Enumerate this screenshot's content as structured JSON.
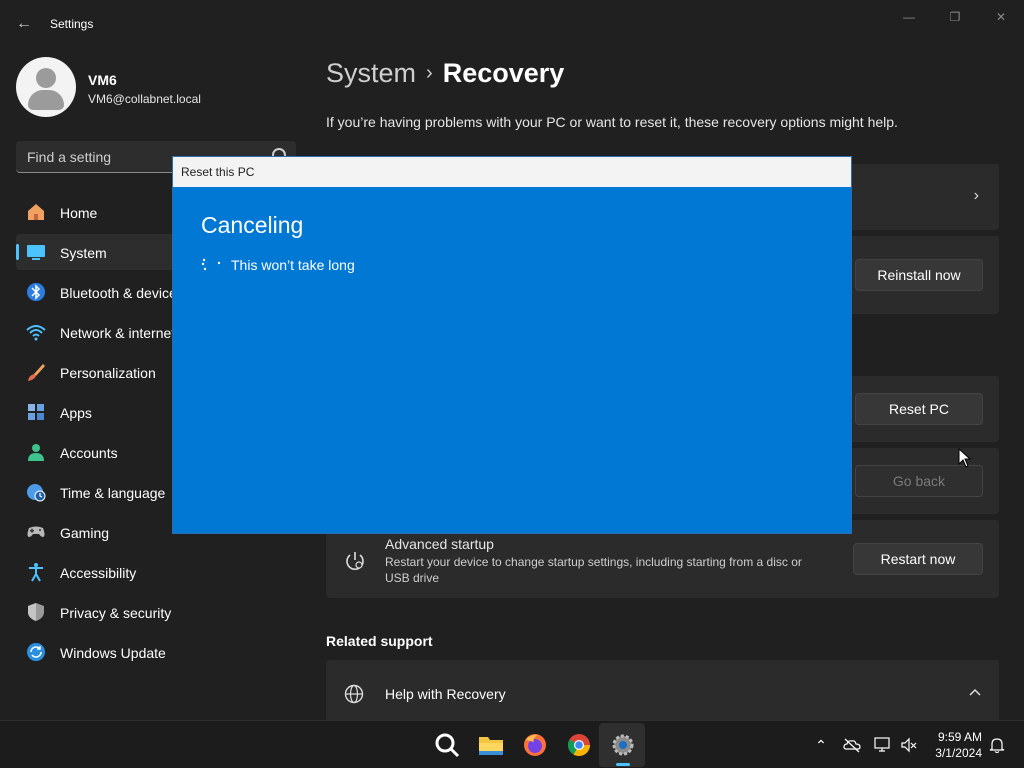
{
  "window": {
    "app_title": "Settings",
    "controls": {
      "minimize": "—",
      "maximize": "❐",
      "close": "✕"
    }
  },
  "profile": {
    "name": "VM6",
    "email": "VM6@collabnet.local"
  },
  "search": {
    "placeholder": "Find a setting"
  },
  "sidebar": {
    "items": [
      {
        "label": "Home",
        "icon": "home-icon"
      },
      {
        "label": "System",
        "icon": "system-icon",
        "active": true
      },
      {
        "label": "Bluetooth & devices",
        "icon": "bluetooth-icon"
      },
      {
        "label": "Network & internet",
        "icon": "network-icon"
      },
      {
        "label": "Personalization",
        "icon": "brush-icon"
      },
      {
        "label": "Apps",
        "icon": "apps-icon"
      },
      {
        "label": "Accounts",
        "icon": "accounts-icon"
      },
      {
        "label": "Time & language",
        "icon": "clock-globe-icon"
      },
      {
        "label": "Gaming",
        "icon": "gamepad-icon"
      },
      {
        "label": "Accessibility",
        "icon": "accessibility-icon"
      },
      {
        "label": "Privacy & security",
        "icon": "shield-icon"
      },
      {
        "label": "Windows Update",
        "icon": "update-icon"
      }
    ]
  },
  "main": {
    "breadcrumb": {
      "parent": "System",
      "separator": "›",
      "current": "Recovery"
    },
    "intro": "If you’re having problems with your PC or want to reset it, these recovery options might help.",
    "buttons": {
      "reinstall": "Reinstall now",
      "reset": "Reset PC",
      "go_back": "Go back",
      "restart": "Restart now"
    },
    "advanced_startup": {
      "title": "Advanced startup",
      "description": "Restart your device to change startup settings, including starting from a disc or USB drive"
    },
    "related_support": {
      "heading": "Related support",
      "help_title": "Help with Recovery"
    }
  },
  "dialog": {
    "title": "Reset this PC",
    "heading": "Canceling",
    "status": "This won’t take long"
  },
  "taskbar": {
    "apps": [
      "search-icon",
      "file-explorer-icon",
      "firefox-icon",
      "chrome-icon",
      "settings-icon"
    ],
    "clock": {
      "time": "9:59 AM",
      "date": "3/1/2024"
    }
  },
  "colors": {
    "accent": "#4cc2ff",
    "dialog_bg": "#0078d4",
    "window_bg": "#202020",
    "card_bg": "#2b2b2b"
  }
}
